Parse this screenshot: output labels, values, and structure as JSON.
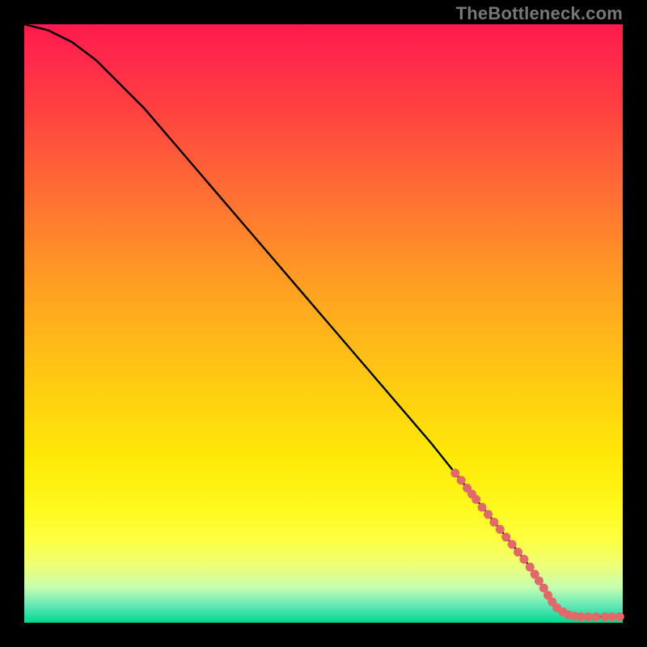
{
  "watermark": "TheBottleneck.com",
  "colors": {
    "curve": "#000000",
    "marker": "#e06a6a",
    "background_top": "#ff1a4d",
    "background_bottom": "#00d890"
  },
  "chart_data": {
    "type": "line",
    "title": "",
    "xlabel": "",
    "ylabel": "",
    "xlim": [
      0,
      100
    ],
    "ylim": [
      0,
      100
    ],
    "grid": false,
    "legend": false,
    "series": [
      {
        "name": "curve",
        "x": [
          0,
          4,
          8,
          12,
          16,
          20,
          26,
          32,
          38,
          44,
          50,
          56,
          62,
          68,
          72,
          76,
          80,
          84,
          86,
          88,
          90,
          92,
          94,
          96,
          98,
          100
        ],
        "y": [
          100,
          99,
          97,
          94,
          90,
          86,
          79,
          72,
          65,
          58,
          51,
          44,
          37,
          30,
          25,
          20,
          15,
          10,
          7,
          4,
          2,
          1,
          1,
          1,
          1,
          1
        ]
      }
    ],
    "markers": [
      {
        "x": 72.0,
        "y": 25.0
      },
      {
        "x": 73.0,
        "y": 23.8
      },
      {
        "x": 74.0,
        "y": 22.5
      },
      {
        "x": 74.8,
        "y": 21.5
      },
      {
        "x": 75.5,
        "y": 20.6
      },
      {
        "x": 76.5,
        "y": 19.3
      },
      {
        "x": 77.5,
        "y": 18.1
      },
      {
        "x": 78.5,
        "y": 16.8
      },
      {
        "x": 79.5,
        "y": 15.6
      },
      {
        "x": 80.5,
        "y": 14.3
      },
      {
        "x": 81.5,
        "y": 13.1
      },
      {
        "x": 82.5,
        "y": 11.8
      },
      {
        "x": 83.5,
        "y": 10.6
      },
      {
        "x": 84.5,
        "y": 9.3
      },
      {
        "x": 85.3,
        "y": 8.1
      },
      {
        "x": 86.0,
        "y": 7.0
      },
      {
        "x": 86.8,
        "y": 5.8
      },
      {
        "x": 87.5,
        "y": 4.6
      },
      {
        "x": 88.2,
        "y": 3.5
      },
      {
        "x": 89.0,
        "y": 2.5
      },
      {
        "x": 90.0,
        "y": 1.8
      },
      {
        "x": 91.0,
        "y": 1.3
      },
      {
        "x": 92.0,
        "y": 1.1
      },
      {
        "x": 93.0,
        "y": 1.0
      },
      {
        "x": 94.2,
        "y": 1.0
      },
      {
        "x": 95.5,
        "y": 1.0
      },
      {
        "x": 97.0,
        "y": 1.0
      },
      {
        "x": 98.2,
        "y": 1.0
      },
      {
        "x": 99.5,
        "y": 1.0
      }
    ],
    "marker_style": {
      "r": 5.5,
      "fill": "#e06a6a"
    }
  }
}
